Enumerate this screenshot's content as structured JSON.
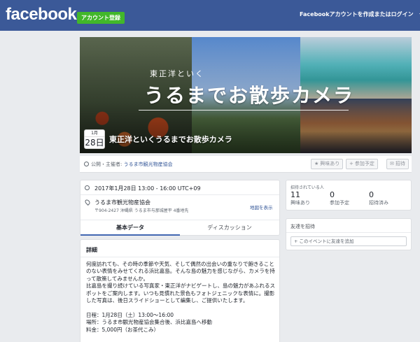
{
  "header": {
    "logo": "facebook",
    "signup_label": "アカウント登録",
    "login_label": "Facebookアカウントを作成またはログイン"
  },
  "cover": {
    "subtitle": "東正洋といく",
    "main_title": "うるまでお散歩カメラ",
    "date_month": "1月",
    "date_day": "28日",
    "event_title": "東正洋といくうるまでお散歩カメラ"
  },
  "host": {
    "prefix": "公開・主催者:",
    "name": "うるま市観光物産協会"
  },
  "actions": {
    "interested": "興味あり",
    "going": "参加予定",
    "share": "招待"
  },
  "info": {
    "time": "2017年1月28日 13:00 - 16:00 UTC+09",
    "place_name": "うるま市観光物産協会",
    "place_address": "〒904-2427 沖縄県 うるま市与那城屋平 4番地先",
    "map_link": "地図を表示"
  },
  "tabs": {
    "basic": "基本データ",
    "discussion": "ディスカッション"
  },
  "details": {
    "title": "詳細",
    "body": "何度訪れても、その時の季節や天気、そして偶然の出会いの重なりで飽きることのない表情をみせてくれる浜比嘉島。そんな島の魅力を感じながら、カメラを持って散策してみませんか。\n比嘉島を撮り続けている写真家・東正洋がナビゲートし、島の魅力があふれるスポットをご案内します。いつも見慣れた景色もフォトジェニックな表情に。撮影した写真は、後日スライドショーとして編集し、ご提供いたします。\n\n日程：1月28日（土）13:00〜16:00\n場所：うるま市観光物産協会集合後、浜比嘉島へ移動\n料金：5,000円（お茶代こみ）"
  },
  "stats": {
    "heading": "招待されている人",
    "items": [
      {
        "count": "11",
        "label": "興味あり"
      },
      {
        "count": "0",
        "label": "参加予定"
      },
      {
        "count": "0",
        "label": "招待済み"
      }
    ]
  },
  "invite": {
    "heading": "友達を招待",
    "placeholder": "+ このイベントに友達を追加"
  }
}
